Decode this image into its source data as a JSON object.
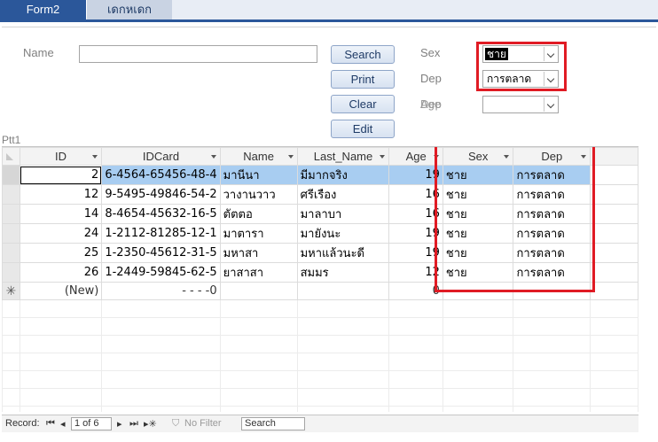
{
  "tabs": [
    {
      "label": "Form2",
      "active": true
    },
    {
      "label": "เดกหเดก",
      "active": false
    }
  ],
  "form": {
    "name_label": "Name",
    "name_value": "",
    "buttons": {
      "search": "Search",
      "print": "Print",
      "clear": "Clear",
      "edit": "Edit"
    },
    "sex_label": "Sex",
    "sex_value": "ชาย",
    "dep_label": "Dep",
    "dep_value": "การตลาด",
    "age_label": "Age",
    "age_value": "",
    "section_label": "Ptt1"
  },
  "table": {
    "columns": [
      "ID",
      "IDCard",
      "Name",
      "Last_Name",
      "Age",
      "Sex",
      "Dep"
    ],
    "rows": [
      {
        "ID": "2",
        "IDCard": "6-4564-65456-48-4",
        "Name": "มานีนา",
        "Last_Name": "มีมากจริง",
        "Age": "19",
        "Sex": "ชาย",
        "Dep": "การตลาด"
      },
      {
        "ID": "12",
        "IDCard": "9-5495-49846-54-2",
        "Name": "วางานวาว",
        "Last_Name": "ศรีเรือง",
        "Age": "16",
        "Sex": "ชาย",
        "Dep": "การตลาด"
      },
      {
        "ID": "14",
        "IDCard": "8-4654-45632-16-5",
        "Name": "ตัตตอ",
        "Last_Name": "มาลาบา",
        "Age": "16",
        "Sex": "ชาย",
        "Dep": "การตลาด"
      },
      {
        "ID": "24",
        "IDCard": "1-2112-81285-12-1",
        "Name": "มาตารา",
        "Last_Name": "มายังนะ",
        "Age": "19",
        "Sex": "ชาย",
        "Dep": "การตลาด"
      },
      {
        "ID": "25",
        "IDCard": "1-2350-45612-31-5",
        "Name": "มหาสา",
        "Last_Name": "มหาแล้วนะดี",
        "Age": "19",
        "Sex": "ชาย",
        "Dep": "การตลาด"
      },
      {
        "ID": "26",
        "IDCard": "1-2449-59845-62-5",
        "Name": "ยาสาสา",
        "Last_Name": "สมมร",
        "Age": "12",
        "Sex": "ชาย",
        "Dep": "การตลาด"
      }
    ],
    "new_row": {
      "ID": "(New)",
      "IDCard": "-  -    -  -0",
      "Age": "0"
    }
  },
  "nav": {
    "record_label": "Record:",
    "position": "1 of 6",
    "filter_label": "No Filter",
    "search_label": "Search"
  },
  "colors": {
    "accent": "#2b579a",
    "highlight": "#e01b24",
    "current_row": "#a8cdf1"
  }
}
